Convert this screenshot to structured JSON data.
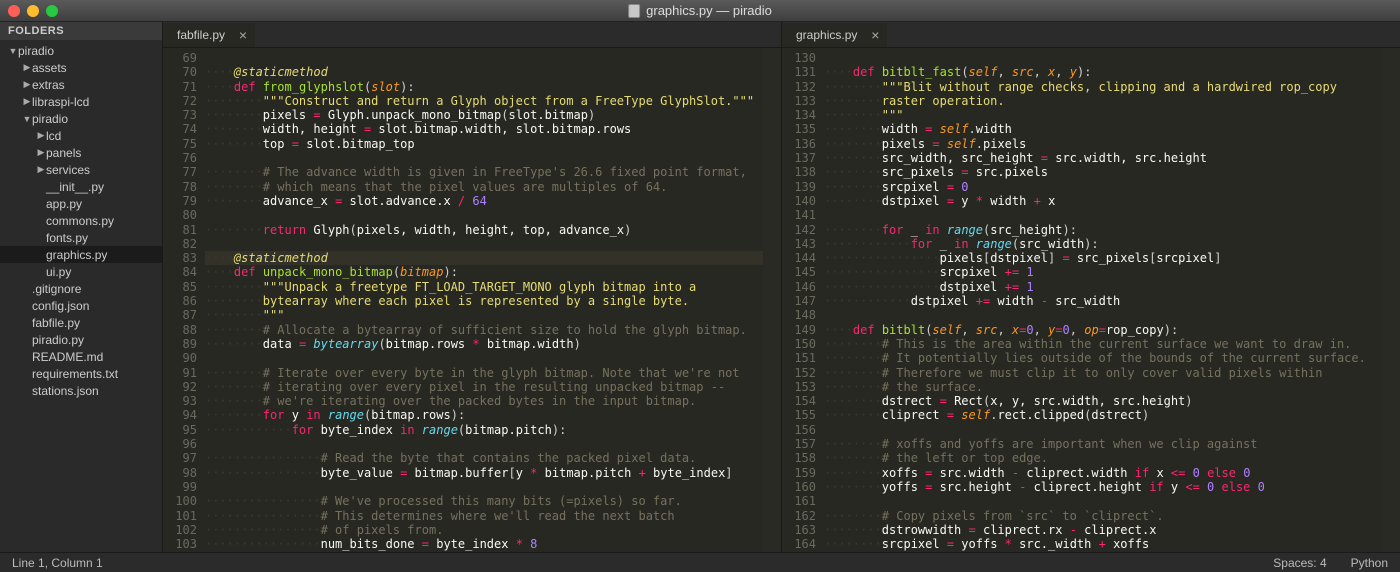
{
  "window": {
    "title": "graphics.py — piradio"
  },
  "sidebar": {
    "header": "FOLDERS",
    "items": [
      {
        "label": "piradio",
        "arrow": "▼",
        "indent": 1
      },
      {
        "label": "assets",
        "arrow": "▶",
        "indent": 2
      },
      {
        "label": "extras",
        "arrow": "▶",
        "indent": 2
      },
      {
        "label": "libraspi-lcd",
        "arrow": "▶",
        "indent": 2
      },
      {
        "label": "piradio",
        "arrow": "▼",
        "indent": 2
      },
      {
        "label": "lcd",
        "arrow": "▶",
        "indent": 3
      },
      {
        "label": "panels",
        "arrow": "▶",
        "indent": 3
      },
      {
        "label": "services",
        "arrow": "▶",
        "indent": 3
      },
      {
        "label": "__init__.py",
        "arrow": "",
        "indent": 3
      },
      {
        "label": "app.py",
        "arrow": "",
        "indent": 3
      },
      {
        "label": "commons.py",
        "arrow": "",
        "indent": 3
      },
      {
        "label": "fonts.py",
        "arrow": "",
        "indent": 3
      },
      {
        "label": "graphics.py",
        "arrow": "",
        "indent": 3,
        "sel": true
      },
      {
        "label": "ui.py",
        "arrow": "",
        "indent": 3
      },
      {
        "label": ".gitignore",
        "arrow": "",
        "indent": 2
      },
      {
        "label": "config.json",
        "arrow": "",
        "indent": 2
      },
      {
        "label": "fabfile.py",
        "arrow": "",
        "indent": 2
      },
      {
        "label": "piradio.py",
        "arrow": "",
        "indent": 2
      },
      {
        "label": "README.md",
        "arrow": "",
        "indent": 2
      },
      {
        "label": "requirements.txt",
        "arrow": "",
        "indent": 2
      },
      {
        "label": "stations.json",
        "arrow": "",
        "indent": 2
      }
    ]
  },
  "tabs_left": [
    {
      "name": "fabfile.py",
      "active": true
    }
  ],
  "tabs_right": [
    {
      "name": "graphics.py",
      "active": true
    }
  ],
  "left_start": 69,
  "right_start": 130,
  "left_lines": [
    "",
    "<span class='ws'>····</span><span class='dec'>@staticmethod</span>",
    "<span class='ws'>····</span><span class='kw'>def</span> <span class='fn'>from_glyphslot</span>(<span class='arg'>slot</span>):",
    "<span class='ws'>········</span><span class='str'>\"\"\"Construct and return a Glyph object from a FreeType GlyphSlot.\"\"\"</span>",
    "<span class='ws'>········</span><span class='id'>pixels</span> <span class='op'>=</span> <span class='id'>Glyph.unpack_mono_bitmap</span>(<span class='id'>slot.bitmap</span>)",
    "<span class='ws'>········</span><span class='id'>width, height</span> <span class='op'>=</span> <span class='id'>slot.bitmap.width, slot.bitmap.rows</span>",
    "<span class='ws'>········</span><span class='id'>top</span> <span class='op'>=</span> <span class='id'>slot.bitmap_top</span>",
    "",
    "<span class='ws'>········</span><span class='cmt'># The advance width is given in FreeType's 26.6 fixed point format,</span>",
    "<span class='ws'>········</span><span class='cmt'># which means that the pixel values are multiples of 64.</span>",
    "<span class='ws'>········</span><span class='id'>advance_x</span> <span class='op'>=</span> <span class='id'>slot.advance.x</span> <span class='op'>/</span> <span class='num'>64</span>",
    "",
    "<span class='ws'>········</span><span class='kw'>return</span> <span class='id'>Glyph</span>(<span class='id'>pixels, width, height, top, advance_x</span>)",
    "",
    "<span class='ws'>····</span><span class='dec'>@staticmethod</span>",
    "<span class='ws'>····</span><span class='kw'>def</span> <span class='fn'>unpack_mono_bitmap</span>(<span class='arg'>bitmap</span>):",
    "<span class='ws'>········</span><span class='str'>\"\"\"Unpack a freetype FT_LOAD_TARGET_MONO glyph bitmap into a</span>",
    "<span class='ws'>········</span><span class='str'>bytearray where each pixel is represented by a single byte.</span>",
    "<span class='ws'>········</span><span class='str'>\"\"\"</span>",
    "<span class='ws'>········</span><span class='cmt'># Allocate a bytearray of sufficient size to hold the glyph bitmap.</span>",
    "<span class='ws'>········</span><span class='id'>data</span> <span class='op'>=</span> <span class='cls'>bytearray</span>(<span class='id'>bitmap.rows</span> <span class='op'>*</span> <span class='id'>bitmap.width</span>)",
    "",
    "<span class='ws'>········</span><span class='cmt'># Iterate over every byte in the glyph bitmap. Note that we're not</span>",
    "<span class='ws'>········</span><span class='cmt'># iterating over every pixel in the resulting unpacked bitmap --</span>",
    "<span class='ws'>········</span><span class='cmt'># we're iterating over the packed bytes in the input bitmap.</span>",
    "<span class='ws'>········</span><span class='kw'>for</span> <span class='id'>y</span> <span class='kw'>in</span> <span class='cls'>range</span>(<span class='id'>bitmap.rows</span>):",
    "<span class='ws'>············</span><span class='kw'>for</span> <span class='id'>byte_index</span> <span class='kw'>in</span> <span class='cls'>range</span>(<span class='id'>bitmap.pitch</span>):",
    "",
    "<span class='ws'>················</span><span class='cmt'># Read the byte that contains the packed pixel data.</span>",
    "<span class='ws'>················</span><span class='id'>byte_value</span> <span class='op'>=</span> <span class='id'>bitmap.buffer</span>[<span class='id'>y</span> <span class='op'>*</span> <span class='id'>bitmap.pitch</span> <span class='op'>+</span> <span class='id'>byte_index</span>]",
    "",
    "<span class='ws'>················</span><span class='cmt'># We've processed this many bits (=pixels) so far.</span>",
    "<span class='ws'>················</span><span class='cmt'># This determines where we'll read the next batch</span>",
    "<span class='ws'>················</span><span class='cmt'># of pixels from.</span>",
    "<span class='ws'>················</span><span class='id'>num_bits_done</span> <span class='op'>=</span> <span class='id'>byte_index</span> <span class='op'>*</span> <span class='num'>8</span>"
  ],
  "right_lines": [
    "",
    "<span class='ws'>····</span><span class='kw'>def</span> <span class='fn'>bitblt_fast</span>(<span class='arg'>self</span>, <span class='arg'>src</span>, <span class='arg'>x</span>, <span class='arg'>y</span>):",
    "<span class='ws'>········</span><span class='str'>\"\"\"Blit without range checks, clipping and a hardwired rop_copy</span>",
    "<span class='ws'>········</span><span class='str'>raster operation.</span>",
    "<span class='ws'>········</span><span class='str'>\"\"\"</span>",
    "<span class='ws'>········</span><span class='id'>width</span> <span class='op'>=</span> <span class='self'>self</span>.<span class='id'>width</span>",
    "<span class='ws'>········</span><span class='id'>pixels</span> <span class='op'>=</span> <span class='self'>self</span>.<span class='id'>pixels</span>",
    "<span class='ws'>········</span><span class='id'>src_width, src_height</span> <span class='op'>=</span> <span class='id'>src.width, src.height</span>",
    "<span class='ws'>········</span><span class='id'>src_pixels</span> <span class='op'>=</span> <span class='id'>src.pixels</span>",
    "<span class='ws'>········</span><span class='id'>srcpixel</span> <span class='op'>=</span> <span class='num'>0</span>",
    "<span class='ws'>········</span><span class='id'>dstpixel</span> <span class='op'>=</span> <span class='id'>y</span> <span class='op'>*</span> <span class='id'>width</span> <span class='op'>+</span> <span class='id'>x</span>",
    "",
    "<span class='ws'>········</span><span class='kw'>for</span> <span class='id'>_</span> <span class='kw'>in</span> <span class='cls'>range</span>(<span class='id'>src_height</span>):",
    "<span class='ws'>············</span><span class='kw'>for</span> <span class='id'>_</span> <span class='kw'>in</span> <span class='cls'>range</span>(<span class='id'>src_width</span>):",
    "<span class='ws'>················</span><span class='id'>pixels</span>[<span class='id'>dstpixel</span>] <span class='op'>=</span> <span class='id'>src_pixels</span>[<span class='id'>srcpixel</span>]",
    "<span class='ws'>················</span><span class='id'>srcpixel</span> <span class='op'>+=</span> <span class='num'>1</span>",
    "<span class='ws'>················</span><span class='id'>dstpixel</span> <span class='op'>+=</span> <span class='num'>1</span>",
    "<span class='ws'>············</span><span class='id'>dstpixel</span> <span class='op'>+=</span> <span class='id'>width</span> <span class='op'>-</span> <span class='id'>src_width</span>",
    "",
    "<span class='ws'>····</span><span class='kw'>def</span> <span class='fn'>bitblt</span>(<span class='arg'>self</span>, <span class='arg'>src</span>, <span class='arg'>x</span><span class='op'>=</span><span class='num'>0</span>, <span class='arg'>y</span><span class='op'>=</span><span class='num'>0</span>, <span class='arg'>op</span><span class='op'>=</span><span class='id'>rop_copy</span>):",
    "<span class='ws'>········</span><span class='cmt'># This is the area within the current surface we want to draw in.</span>",
    "<span class='ws'>········</span><span class='cmt'># It potentially lies outside of the bounds of the current surface.</span>",
    "<span class='ws'>········</span><span class='cmt'># Therefore we must clip it to only cover valid pixels within</span>",
    "<span class='ws'>········</span><span class='cmt'># the surface.</span>",
    "<span class='ws'>········</span><span class='id'>dstrect</span> <span class='op'>=</span> <span class='id'>Rect</span>(<span class='id'>x, y, src.width, src.height</span>)",
    "<span class='ws'>········</span><span class='id'>cliprect</span> <span class='op'>=</span> <span class='self'>self</span>.<span class='id'>rect.clipped</span>(<span class='id'>dstrect</span>)",
    "",
    "<span class='ws'>········</span><span class='cmt'># xoffs and yoffs are important when we clip against</span>",
    "<span class='ws'>········</span><span class='cmt'># the left or top edge.</span>",
    "<span class='ws'>········</span><span class='id'>xoffs</span> <span class='op'>=</span> <span class='id'>src.width</span> <span class='op'>-</span> <span class='id'>cliprect.width</span> <span class='kw'>if</span> <span class='id'>x</span> <span class='op'>&lt;=</span> <span class='num'>0</span> <span class='kw'>else</span> <span class='num'>0</span>",
    "<span class='ws'>········</span><span class='id'>yoffs</span> <span class='op'>=</span> <span class='id'>src.height</span> <span class='op'>-</span> <span class='id'>cliprect.height</span> <span class='kw'>if</span> <span class='id'>y</span> <span class='op'>&lt;=</span> <span class='num'>0</span> <span class='kw'>else</span> <span class='num'>0</span>",
    "",
    "<span class='ws'>········</span><span class='cmt'># Copy pixels from `src` to `cliprect`.</span>",
    "<span class='ws'>········</span><span class='id'>dstrowwidth</span> <span class='op'>=</span> <span class='id'>cliprect.rx</span> <span class='op'>-</span> <span class='id'>cliprect.x</span>",
    "<span class='ws'>········</span><span class='id'>srcpixel</span> <span class='op'>=</span> <span class='id'>yoffs</span> <span class='op'>*</span> <span class='id'>src._width</span> <span class='op'>+</span> <span class='id'>xoffs</span>"
  ],
  "status": {
    "left": "Line 1, Column 1",
    "spaces": "Spaces: 4",
    "lang": "Python"
  }
}
